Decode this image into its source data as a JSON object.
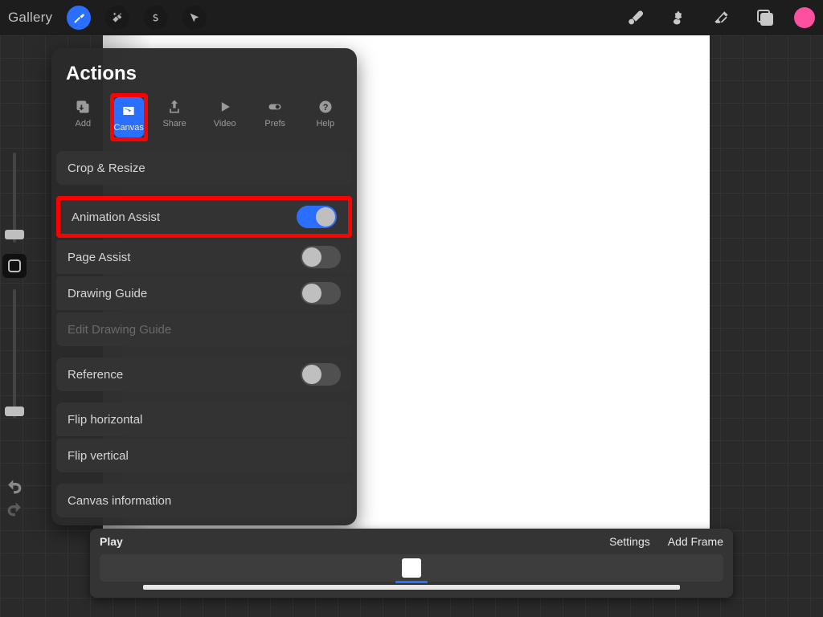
{
  "topbar": {
    "gallery": "Gallery"
  },
  "actions": {
    "title": "Actions",
    "tabs": {
      "add": "Add",
      "canvas": "Canvas",
      "share": "Share",
      "video": "Video",
      "prefs": "Prefs",
      "help": "Help"
    },
    "rows": {
      "crop_resize": "Crop & Resize",
      "animation_assist": "Animation Assist",
      "page_assist": "Page Assist",
      "drawing_guide": "Drawing Guide",
      "edit_drawing_guide": "Edit Drawing Guide",
      "reference": "Reference",
      "flip_h": "Flip horizontal",
      "flip_v": "Flip vertical",
      "canvas_info": "Canvas information"
    },
    "toggles": {
      "animation_assist": true,
      "page_assist": false,
      "drawing_guide": false,
      "reference": false
    }
  },
  "timeline": {
    "play": "Play",
    "settings": "Settings",
    "add_frame": "Add Frame"
  },
  "colors": {
    "accent": "#2a6fff",
    "highlight": "#ff0000",
    "swatch": "#ff4fa0"
  }
}
